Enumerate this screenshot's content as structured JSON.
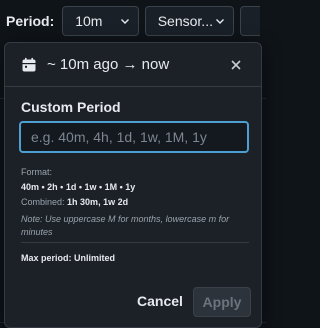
{
  "toolbar": {
    "period_label": "Period:",
    "period_value": "10m",
    "sensor_value": "Sensor..."
  },
  "popover": {
    "title": "~ 10m ago → now",
    "close_icon": "close-icon",
    "calendar_icon": "calendar-icon",
    "section_title": "Custom Period",
    "input_placeholder": "e.g. 40m, 4h, 1d, 1w, 1M, 1y",
    "input_value": "",
    "format_label": "Format:",
    "format_units": "40m • 2h • 1d • 1w • 1M • 1y",
    "combined_label": "Combined:",
    "combined_value": "1h 30m, 1w 2d",
    "note": "Note: Use uppercase M for months, lowercase m for minutes",
    "max_period": "Max period: Unlimited",
    "cancel_label": "Cancel",
    "apply_label": "Apply"
  },
  "colors": {
    "accent": "#4e9fd1",
    "background": "#0f1419",
    "panel": "#1c2128"
  }
}
